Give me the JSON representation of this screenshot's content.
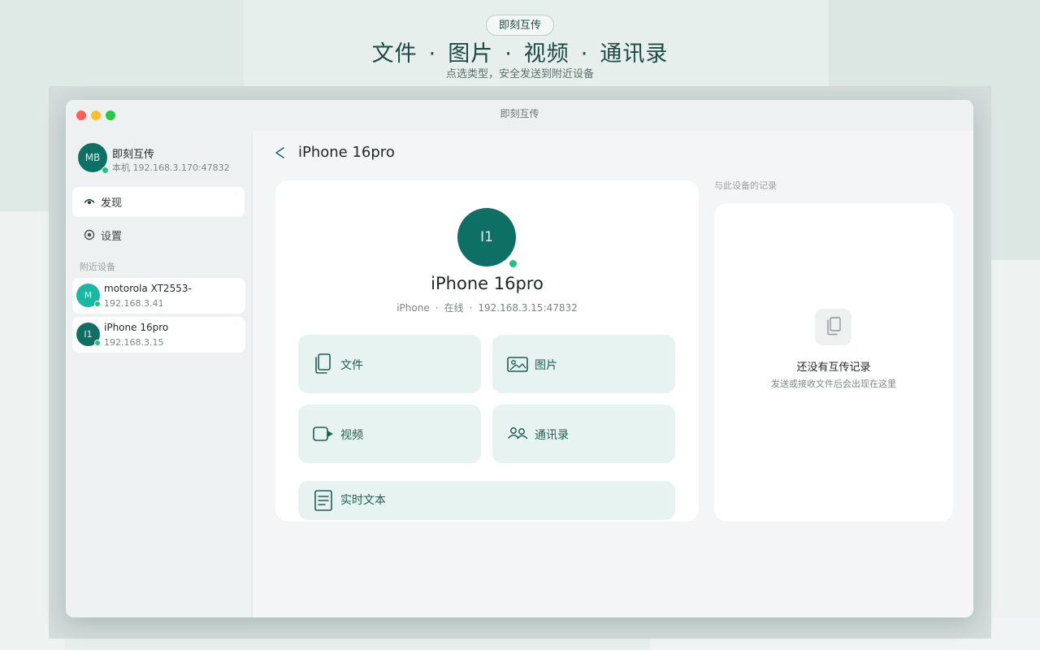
{
  "hero": {
    "badge": "即刻互传",
    "title_items": [
      "文件",
      "图片",
      "视频",
      "通讯录"
    ],
    "separator": "·",
    "subtitle": "点选类型，安全发送到附近设备"
  },
  "window": {
    "title": "即刻互传"
  },
  "sidebar": {
    "me": {
      "initials": "MB",
      "name": "即刻互传",
      "address": "本机 192.168.3.170:47832"
    },
    "nav": [
      {
        "label": "发现",
        "icon": "eye-icon",
        "active": true
      },
      {
        "label": "设置",
        "icon": "settings-icon",
        "active": false
      }
    ],
    "section_label": "附近设备",
    "devices": [
      {
        "initials": "M",
        "name": "motorola XT2553-",
        "address": "192.168.3.41"
      },
      {
        "initials": "I1",
        "name": "iPhone 16pro",
        "address": "192.168.3.15"
      }
    ]
  },
  "main": {
    "title": "iPhone 16pro",
    "device": {
      "initials": "I1",
      "name": "iPhone 16pro",
      "type": "iPhone",
      "status": "在线",
      "address": "192.168.3.15:47832"
    },
    "actions": {
      "file": "文件",
      "photo": "图片",
      "video": "视频",
      "contacts": "通讯录",
      "text": "实时文本"
    },
    "history": {
      "label": "与此设备的记录",
      "empty_title": "还没有互传记录",
      "empty_subtitle": "发送或接收文件后会出现在这里"
    }
  },
  "colors": {
    "accent": "#0e6f64",
    "online": "#22c07a",
    "action_bg": "#e7f3f0"
  }
}
